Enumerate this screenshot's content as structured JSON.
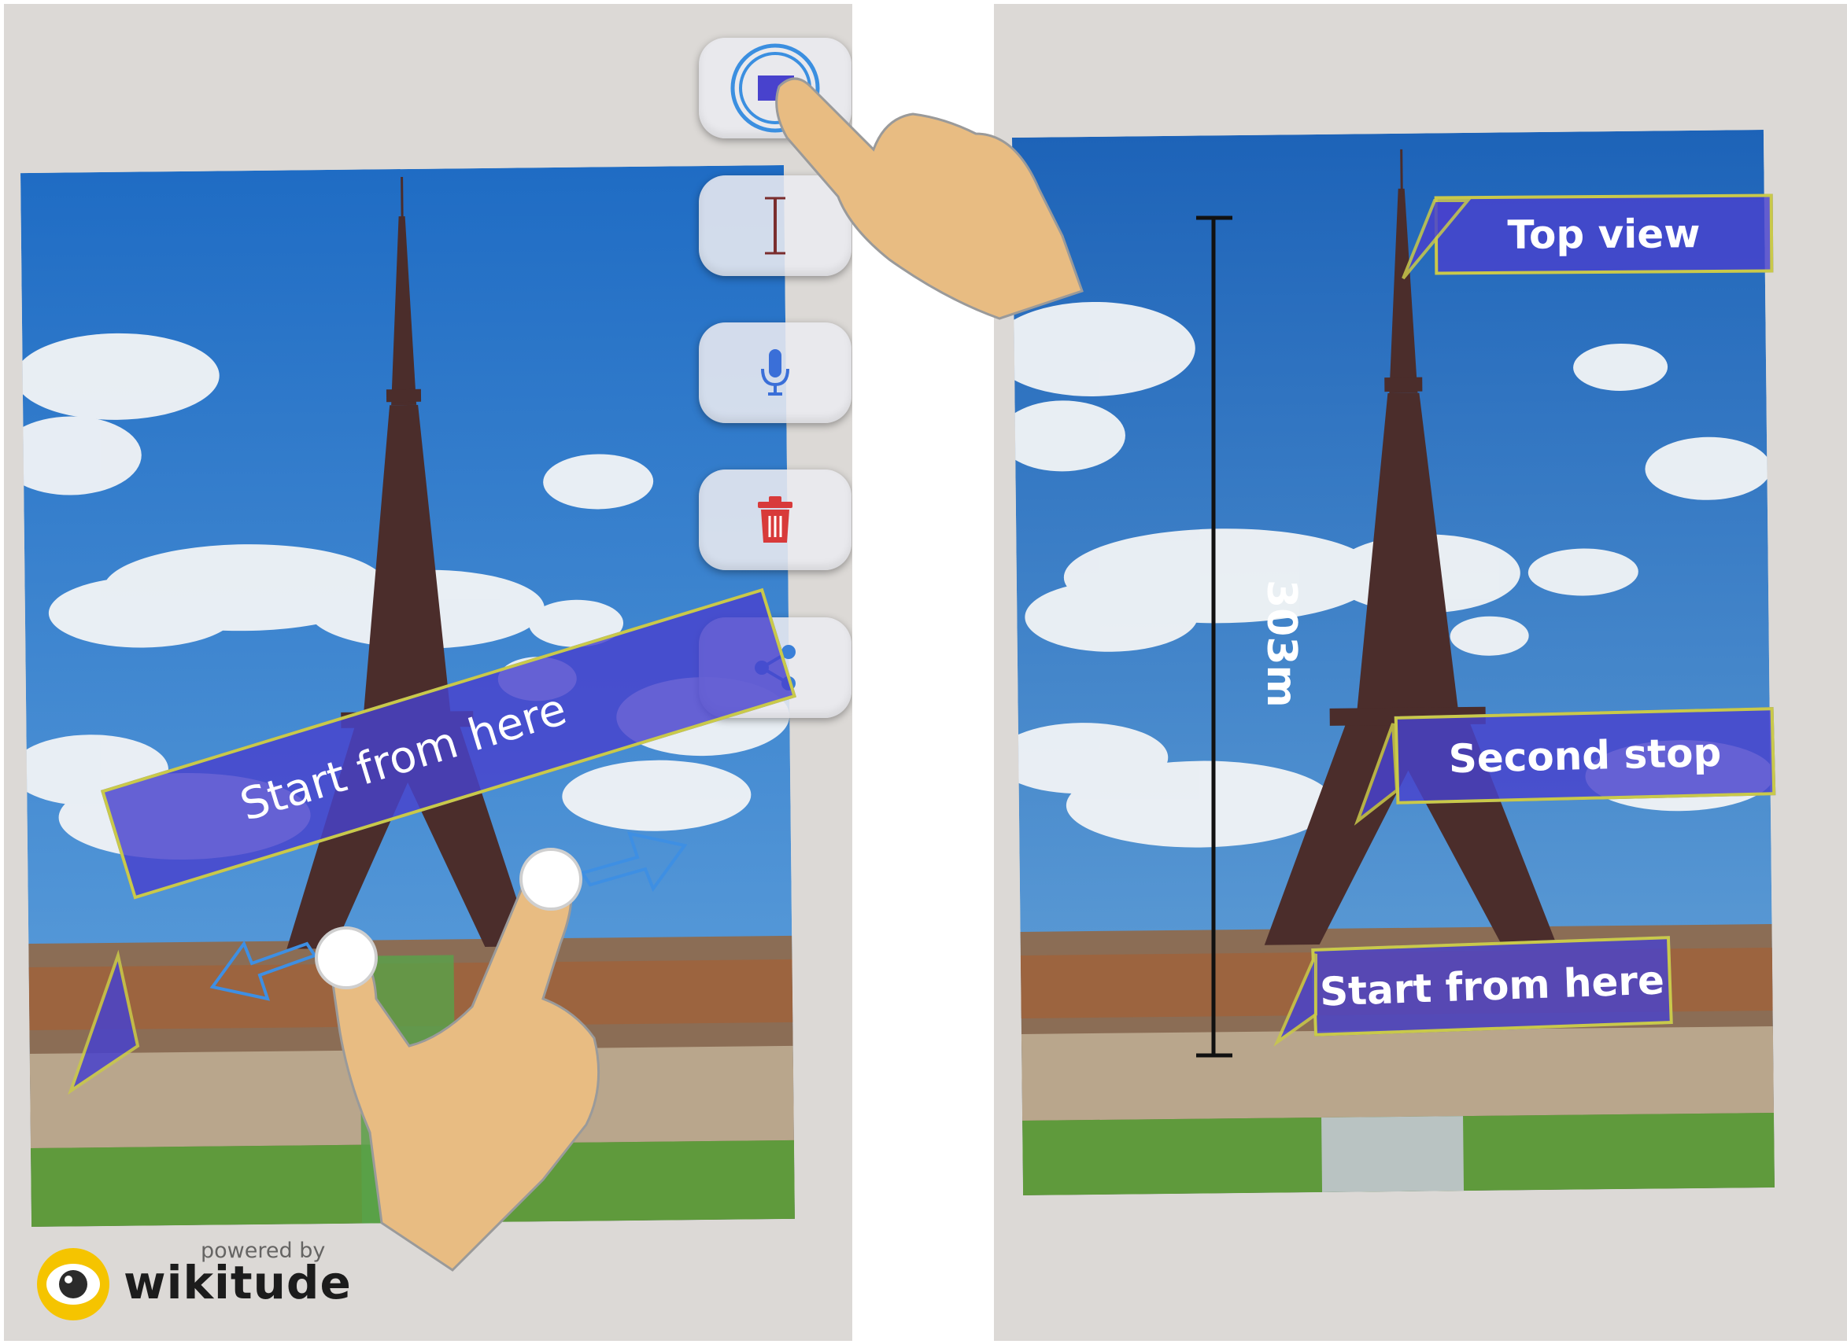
{
  "left_screen": {
    "toolbar": {
      "buttons": [
        {
          "name": "add-label-button",
          "icon": "label-box-icon"
        },
        {
          "name": "add-text-button",
          "icon": "text-cursor-icon"
        },
        {
          "name": "microphone-button",
          "icon": "microphone-icon"
        },
        {
          "name": "delete-button",
          "icon": "trash-icon"
        },
        {
          "name": "share-button",
          "icon": "share-icon"
        }
      ]
    },
    "label": "Start from here",
    "branding": {
      "powered_by": "powered by",
      "brand": "wikitude"
    }
  },
  "right_screen": {
    "labels": {
      "top_view": "Top view",
      "second_stop": "Second stop",
      "start_from_here": "Start from here"
    },
    "measurement": "303m"
  },
  "colors": {
    "label_fill": "#4842cd",
    "label_border": "#c9c94a",
    "sky": "#2f7bd0",
    "hand": "#e8bc82",
    "delete_red": "#d83a3a",
    "mic_blue": "#3a6fd8",
    "share_blue": "#3a7fd8"
  }
}
